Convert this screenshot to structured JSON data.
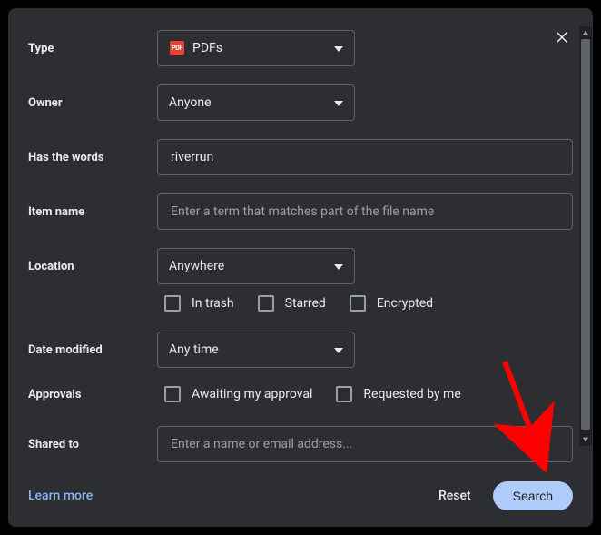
{
  "labels": {
    "type": "Type",
    "owner": "Owner",
    "has_words": "Has the words",
    "item_name": "Item name",
    "location": "Location",
    "date_modified": "Date modified",
    "approvals": "Approvals",
    "shared_to": "Shared to"
  },
  "type": {
    "value": "PDFs",
    "icon": "pdf-icon",
    "badge_text": "PDF"
  },
  "owner": {
    "value": "Anyone"
  },
  "has_words": {
    "value": "riverrun"
  },
  "item_name": {
    "placeholder": "Enter a term that matches part of the file name"
  },
  "location": {
    "value": "Anywhere",
    "options": {
      "in_trash": "In trash",
      "starred": "Starred",
      "encrypted": "Encrypted"
    }
  },
  "date_modified": {
    "value": "Any time"
  },
  "approvals": {
    "awaiting": "Awaiting my approval",
    "requested": "Requested by me"
  },
  "shared_to": {
    "placeholder": "Enter a name or email address..."
  },
  "footer": {
    "learn_more": "Learn more",
    "reset": "Reset",
    "search": "Search"
  }
}
